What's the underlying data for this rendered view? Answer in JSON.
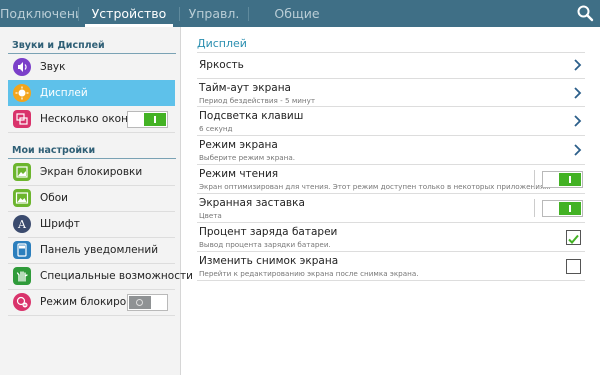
{
  "tabs": [
    {
      "label": "Подключения",
      "active": false
    },
    {
      "label": "Устройство",
      "active": true
    },
    {
      "label": "Управл.",
      "active": false
    },
    {
      "label": "Общие",
      "active": false
    }
  ],
  "search_icon": "search-icon",
  "sidebar": {
    "section1": "Звуки и Дисплей",
    "section2": "Мои настройки",
    "items": [
      {
        "label": "Звук",
        "icon": "speaker-icon",
        "color": "#7b3fc9"
      },
      {
        "label": "Дисплей",
        "icon": "brightness-icon",
        "color": "#f3a51c",
        "selected": true
      },
      {
        "label": "Несколько окон",
        "icon": "multiwindow-icon",
        "color": "#d9336b",
        "toggle": "on"
      },
      {
        "label": "Экран блокировки",
        "icon": "lockscreen-icon",
        "color": "#6cb52d"
      },
      {
        "label": "Обои",
        "icon": "wallpaper-icon",
        "color": "#6cb52d"
      },
      {
        "label": "Шрифт",
        "icon": "font-icon",
        "color": "#3b4b6e"
      },
      {
        "label": "Панель уведомлений",
        "icon": "notification-panel-icon",
        "color": "#2c7fbd"
      },
      {
        "label": "Специальные возможности",
        "icon": "accessibility-icon",
        "color": "#2f9b3a"
      },
      {
        "label": "Режим блокировки",
        "icon": "block-mode-icon",
        "color": "#d9336b",
        "toggle": "off"
      }
    ]
  },
  "main": {
    "heading": "Дисплей",
    "rows": [
      {
        "title": "Яркость",
        "sub": "",
        "control": "chevron"
      },
      {
        "title": "Тайм-аут экрана",
        "sub": "Период бездействия - 5 минут",
        "control": "chevron"
      },
      {
        "title": "Подсветка клавиш",
        "sub": "6 секунд",
        "control": "chevron"
      },
      {
        "title": "Режим экрана",
        "sub": "Выберите режим экрана.",
        "control": "chevron"
      },
      {
        "title": "Режим чтения",
        "sub": "Экран оптимизирован для чтения. Этот режим доступен только в некоторых приложениях.",
        "control": "toggle-on"
      },
      {
        "title": "Экранная заставка",
        "sub": "Цвета",
        "control": "toggle-on"
      },
      {
        "title": "Процент заряда батареи",
        "sub": "Вывод процента зарядки батареи.",
        "control": "checkbox",
        "checked": true
      },
      {
        "title": "Изменить снимок экрана",
        "sub": "Перейти к редактированию экрана после снимка экрана.",
        "control": "checkbox",
        "checked": false
      }
    ]
  },
  "colors": {
    "topbar": "#3f6f86",
    "accent": "#2b8fb0",
    "selected": "#5ec1ea",
    "toggle_on": "#43b224"
  }
}
